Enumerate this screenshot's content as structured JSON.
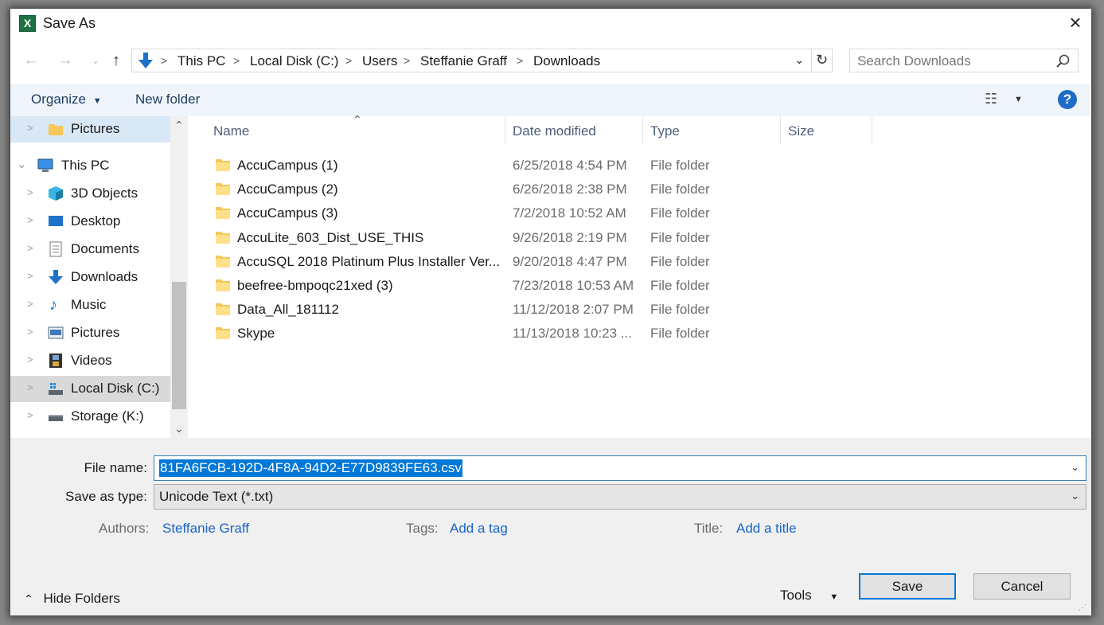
{
  "window": {
    "title": "Save As",
    "app_icon": "excel-icon"
  },
  "address": {
    "crumbs": [
      "This PC",
      "Local Disk (C:)",
      "Users",
      "Steffanie Graff",
      "Downloads"
    ]
  },
  "search": {
    "placeholder": "Search Downloads"
  },
  "toolbar": {
    "organize_label": "Organize",
    "new_folder_label": "New folder"
  },
  "sidebar": {
    "items": [
      {
        "label": "Pictures",
        "icon": "folder-icon"
      },
      {
        "label": "This PC",
        "icon": "computer-icon"
      },
      {
        "label": "3D Objects",
        "icon": "cube-icon"
      },
      {
        "label": "Desktop",
        "icon": "desktop-icon"
      },
      {
        "label": "Documents",
        "icon": "document-icon"
      },
      {
        "label": "Downloads",
        "icon": "download-arrow-icon"
      },
      {
        "label": "Music",
        "icon": "music-note-icon"
      },
      {
        "label": "Pictures",
        "icon": "picture-icon"
      },
      {
        "label": "Videos",
        "icon": "film-icon"
      },
      {
        "label": "Local Disk (C:)",
        "icon": "drive-icon"
      },
      {
        "label": "Storage (K:)",
        "icon": "drive-icon"
      }
    ]
  },
  "files": {
    "columns": [
      "Name",
      "Date modified",
      "Type",
      "Size"
    ],
    "rows": [
      {
        "name": "AccuCampus (1)",
        "date": "6/25/2018 4:54 PM",
        "type": "File folder"
      },
      {
        "name": "AccuCampus (2)",
        "date": "6/26/2018 2:38 PM",
        "type": "File folder"
      },
      {
        "name": "AccuCampus (3)",
        "date": "7/2/2018 10:52 AM",
        "type": "File folder"
      },
      {
        "name": "AccuLite_603_Dist_USE_THIS",
        "date": "9/26/2018 2:19 PM",
        "type": "File folder"
      },
      {
        "name": "AccuSQL 2018 Platinum Plus Installer Ver...",
        "date": "9/20/2018 4:47 PM",
        "type": "File folder"
      },
      {
        "name": "beefree-bmpoqc21xed (3)",
        "date": "7/23/2018 10:53 AM",
        "type": "File folder"
      },
      {
        "name": "Data_All_181112",
        "date": "11/12/2018 2:07 PM",
        "type": "File folder"
      },
      {
        "name": "Skype",
        "date": "11/13/2018 10:23 ...",
        "type": "File folder"
      }
    ]
  },
  "form": {
    "file_name_label": "File name:",
    "file_name_value": "81FA6FCB-192D-4F8A-94D2-E77D9839FE63.csv",
    "save_type_label": "Save as type:",
    "save_type_value": "Unicode Text (*.txt)",
    "authors_label": "Authors:",
    "authors_value": "Steffanie Graff",
    "tags_label": "Tags:",
    "tags_value": "Add a tag",
    "title_label": "Title:",
    "title_value": "Add a title"
  },
  "footer": {
    "hide_folders_label": "Hide Folders",
    "tools_label": "Tools",
    "save_label": "Save",
    "cancel_label": "Cancel"
  },
  "colors": {
    "accent": "#0078d7",
    "link": "#1a64c8",
    "toolbar_bg": "#f0f5fb",
    "excel_green": "#1e7145"
  }
}
